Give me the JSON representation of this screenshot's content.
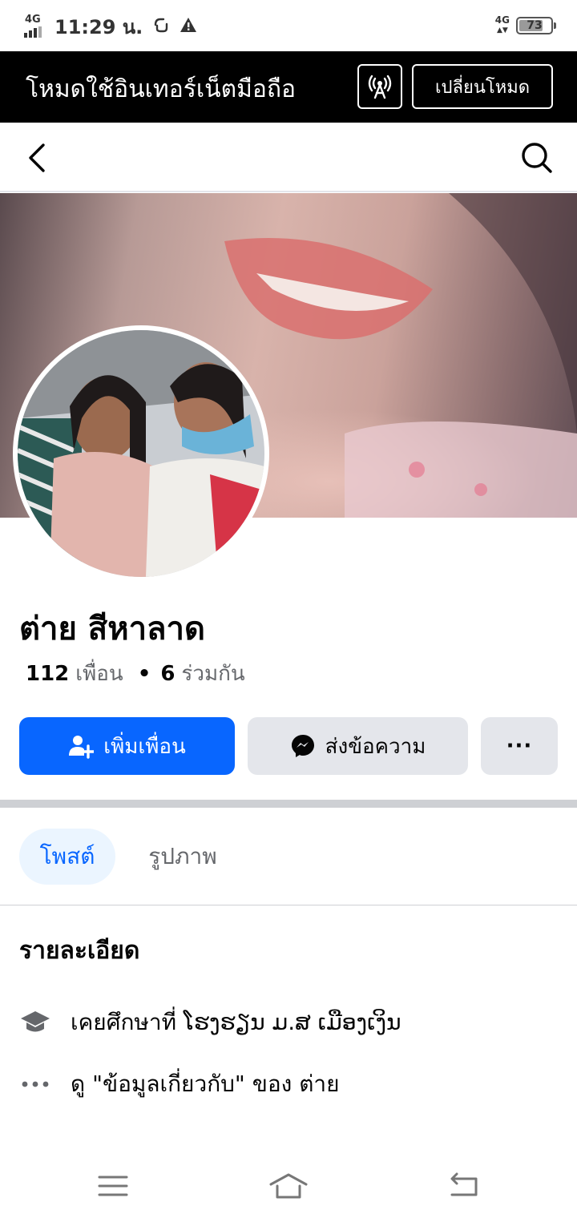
{
  "status_bar": {
    "network": "4G",
    "time": "11:29 น.",
    "right_network": "4G",
    "battery": "73"
  },
  "mode_banner": {
    "text": "โหมดใช้อินเทอร์เน็ตมือถือ",
    "icon": "broadcast-tower-icon",
    "switch_label": "เปลี่ยนโหมด"
  },
  "nav": {
    "back_icon": "back-arrow-icon",
    "search_icon": "search-icon"
  },
  "profile": {
    "name": "ต่าย สีหาลาด",
    "friends_count": "112",
    "friends_label": "เพื่อน",
    "mutual_count": "6",
    "mutual_label": "ร่วมกัน"
  },
  "actions": {
    "add_friend": "เพิ่มเพื่อน",
    "message": "ส่งข้อความ",
    "more": "···"
  },
  "tabs": [
    {
      "label": "โพสต์",
      "active": true
    },
    {
      "label": "รูปภาพ",
      "active": false
    }
  ],
  "details": {
    "title": "รายละเอียด",
    "education": "เคยศึกษาที่ ໂຮງຮຽນ ມ.ສ ເມືອງເງິນ",
    "about_link": "ดู \"ข้อมูลเกี่ยวกับ\" ของ ต่าย"
  },
  "colors": {
    "primary": "#0866ff",
    "secondary_button": "#e4e6eb",
    "active_tab_bg": "#ebf5ff",
    "banner_bg": "#000000"
  }
}
